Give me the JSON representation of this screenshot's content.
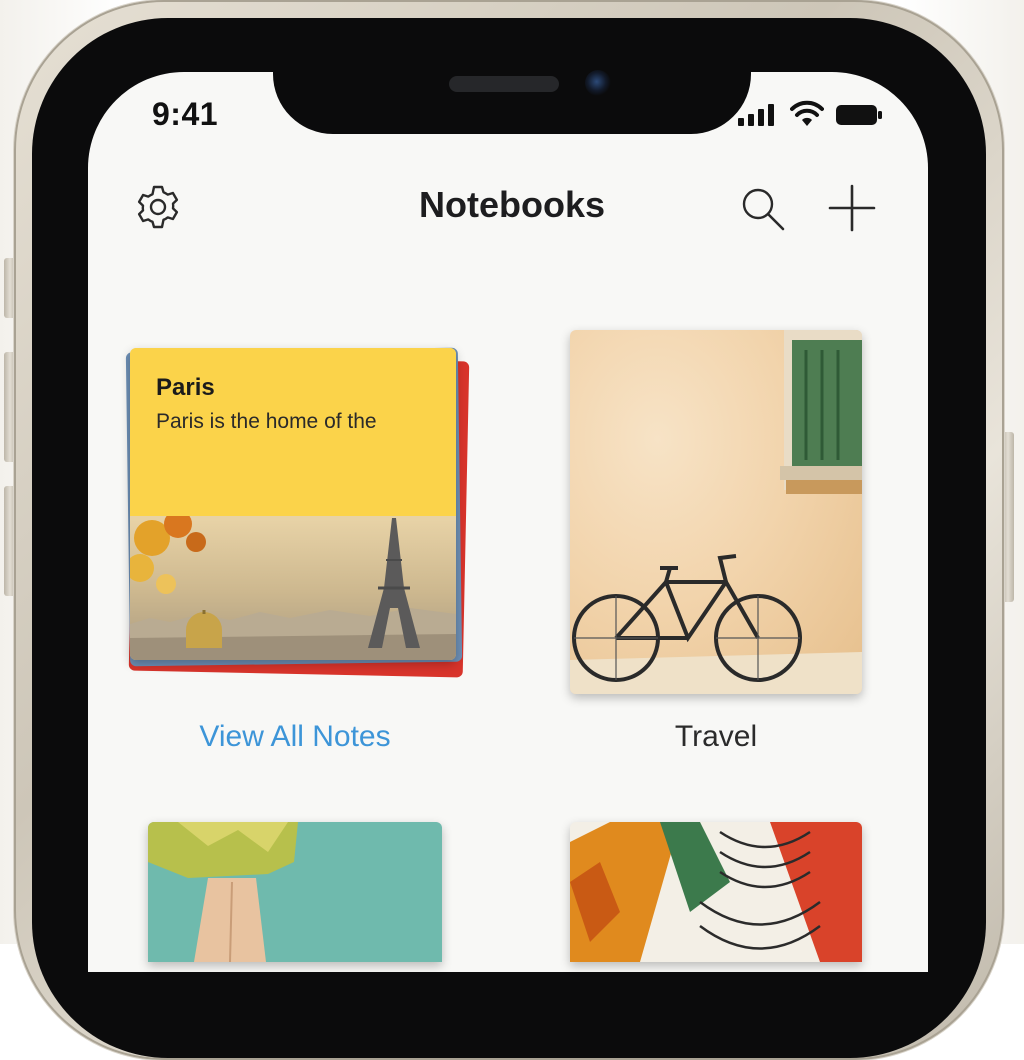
{
  "status_bar": {
    "time": "9:41"
  },
  "nav": {
    "title": "Notebooks",
    "settings_icon": "gear-icon",
    "search_icon": "search-icon",
    "add_icon": "plus-icon"
  },
  "notebooks": [
    {
      "label": "View All Notes",
      "note_title": "Paris",
      "note_preview": "Paris is the home of the",
      "label_color": "#3d95d8"
    },
    {
      "label": "Travel"
    },
    {
      "label": ""
    },
    {
      "label": ""
    }
  ],
  "colors": {
    "accent": "#3d95d8",
    "sticky_note": "#fbd34a",
    "background": "#f8f8f6"
  }
}
